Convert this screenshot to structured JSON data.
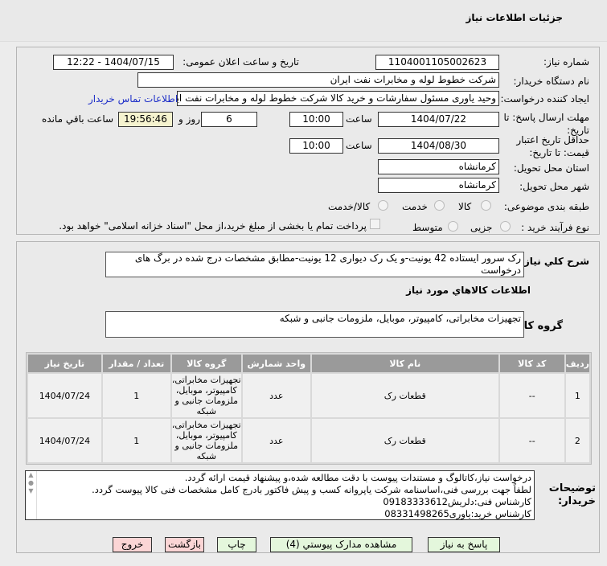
{
  "page_title": "جزئیات اطلاعات نیاز",
  "fields": {
    "need_number_label": "شماره نیاز:",
    "need_number": "1104001105002623",
    "announce_label": "تاریخ و ساعت اعلان عمومی:",
    "announce_value": "1404/07/15 - 12:22",
    "buyer_org_label": "نام دستگاه خریدار:",
    "buyer_org": "شرکت خطوط لوله و مخابرات نفت ایران",
    "creator_label": "ایجاد کننده درخواست:",
    "creator": "وحید یاوری مسئول سفارشات و خرید کالا  شرکت خطوط لوله و مخابرات نفت ایرا",
    "contact_link": "اطلاعات تماس خریدار",
    "deadline_label": "مهلت ارسال پاسخ: تا تاریخ:",
    "deadline_date": "1404/07/22",
    "time_label": "ساعت",
    "deadline_time": "10:00",
    "days": "6",
    "days_label": "روز و",
    "remaining": "19:56:46",
    "remaining_label": "ساعت باقي مانده",
    "validity_label": "حداقل تاریخ اعتبار قیمت: تا تاریخ:",
    "validity_date": "1404/08/30",
    "validity_time": "10:00",
    "province_label": "استان محل تحویل:",
    "province": "کرمانشاه",
    "city_label": "شهر محل تحویل:",
    "city": "کرمانشاه",
    "category_label": "طبقه بندی موضوعی:",
    "category_options": [
      "کالا",
      "خدمت",
      "کالا/خدمت"
    ],
    "process_label": "نوع فرآیند خرید :",
    "process_options": [
      "جزیی",
      "متوسط"
    ],
    "payment_note": "پرداخت تمام یا بخشی از مبلغ خرید،از محل \"اسناد خزانه اسلامی\" خواهد بود."
  },
  "description_label": "شرح كلي نياز:",
  "description": "رک سرور ایستاده 42 یونیت-و یک رک دیواری 12 یونیت-مطابق مشخصات درج شده در برگ های درخواست",
  "goods_info_title": "اطلاعات كالاهاي مورد نياز",
  "goods_group_label": "گروه کالا:",
  "goods_group": "تجهیزات مخابراتی، کامپیوتر، موبایل، ملزومات جانبی و شبکه",
  "table": {
    "headers": [
      "ردیف",
      "کد کالا",
      "نام کالا",
      "واحد شمارش",
      "گروه کالا",
      "تعداد / مقدار",
      "تاریخ نیاز"
    ],
    "rows": [
      [
        "1",
        "--",
        "قطعات رک",
        "عدد",
        "تجهیزات مخابراتی، کامپیوتر، موبایل، ملزومات جانبی و شبکه",
        "1",
        "1404/07/24"
      ],
      [
        "2",
        "--",
        "قطعات رک",
        "عدد",
        "تجهیزات مخابراتی، کامپیوتر، موبایل، ملزومات جانبی و شبکه",
        "1",
        "1404/07/24"
      ]
    ]
  },
  "notes_label": "توضیحات خریدار:",
  "notes": [
    "درخواست نیاز،کاتالوگ و مستندات پیوست با دقت مطالعه شده،و پیشنهاد قیمت ارائه گردد.",
    "لطفاً جهت بررسی فنی،اساسنامه شرکت یاپروانه کسب و پیش فاکتور بادرج کامل مشخصات فنی کالا پیوست گردد.",
    "کارشناس فنی:دلریش09183333612",
    "کارشناس خرید:یاوری08331498265"
  ],
  "buttons": {
    "reply": "پاسخ به نیاز",
    "attachments": "مشاهده مدارک پیوستي (4)",
    "print": "چاپ",
    "back": "بازگشت",
    "exit": "خروج"
  }
}
